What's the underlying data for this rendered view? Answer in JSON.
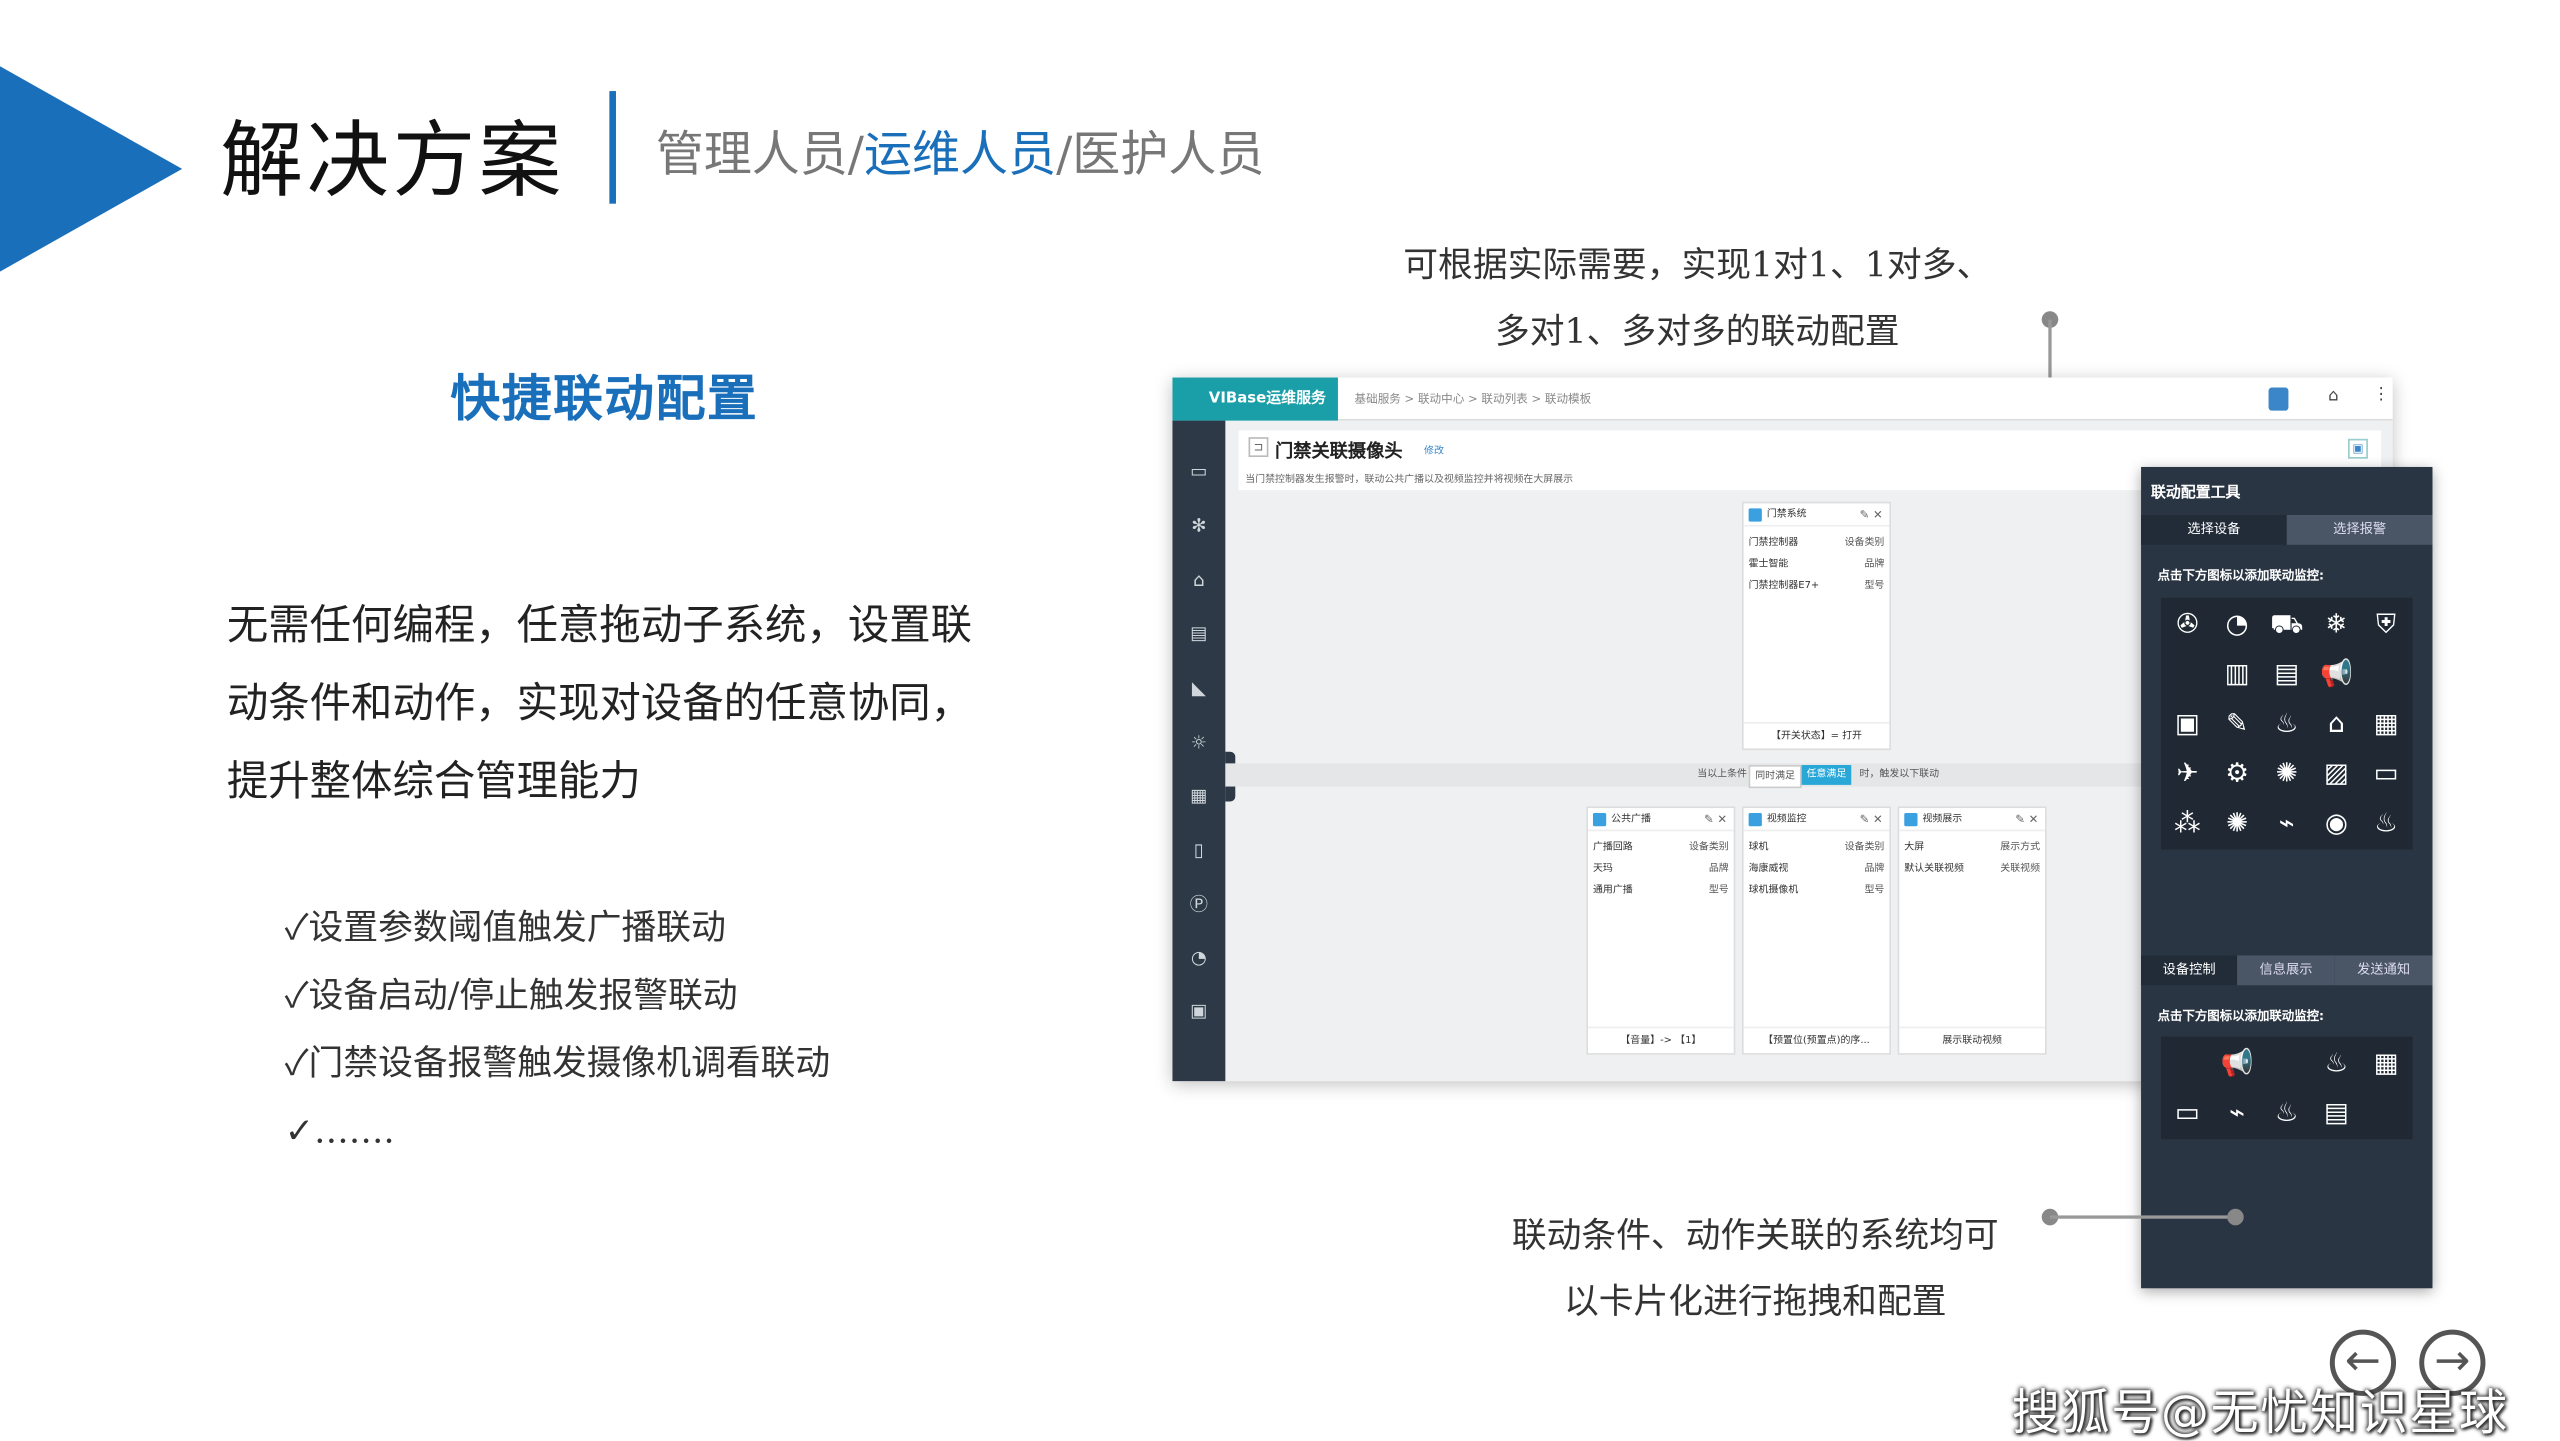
{
  "slide": {
    "title": "解决方案",
    "roles": {
      "a": "管理人员/",
      "b": "运维人员",
      "c": "/医护人员"
    },
    "feature_title": "快捷联动配置",
    "description": "无需任何编程，任意拖动子系统，设置联动条件和动作，实现对设备的任意协同，提升整体综合管理能力",
    "checks": [
      "✓设置参数阈值触发广播联动",
      "✓设备启动/停止触发报警联动",
      "✓门禁设备报警触发摄像机调看联动",
      "✓……."
    ],
    "caption_top_1": "可根据实际需要，实现1对1、1对多、",
    "caption_top_2": "多对1、多对多的联动配置",
    "caption_bottom_1": "联动条件、动作关联的系统均可",
    "caption_bottom_2": "以卡片化进行拖拽和配置",
    "watermark": "搜狐号@无忧知识星球",
    "accent": "#1a6fbb"
  },
  "app": {
    "brand": "VIBase运维服务",
    "breadcrumb": "基础服务 > 联动中心 > 联动列表 > 联动模板",
    "page_title": "门禁关联摄像头",
    "edit_label": "修改",
    "subtitle": "当门禁控制器发生报警时，联动公共广播以及视频监控并将视频在大屏展示",
    "condition_card": {
      "title": "门禁系统",
      "rows": [
        [
          "门禁控制器",
          "设备类别"
        ],
        [
          "霍士智能",
          "品牌"
        ],
        [
          "门禁控制器E7+",
          "型号"
        ]
      ],
      "footer": "【开关状态】= 打开"
    },
    "cond_bar": {
      "pre": "当以上条件",
      "opt1": "同时满足",
      "opt2": "任意满足",
      "post": "时，触发以下联动"
    },
    "action_cards": [
      {
        "title": "公共广播",
        "rows": [
          [
            "广播回路",
            "设备类别"
          ],
          [
            "天玛",
            "品牌"
          ],
          [
            "通用广播",
            "型号"
          ]
        ],
        "footer": "【音量】-> 【1】"
      },
      {
        "title": "视频监控",
        "rows": [
          [
            "球机",
            "设备类别"
          ],
          [
            "海康威视",
            "品牌"
          ],
          [
            "球机摄像机",
            "型号"
          ]
        ],
        "footer": "【预置位(预置点)的序..."
      },
      {
        "title": "视频展示",
        "rows": [
          [
            "大屏",
            "展示方式"
          ],
          [
            "默认关联视频",
            "关联视频"
          ]
        ],
        "footer": "展示联动视频"
      }
    ]
  },
  "tool": {
    "title": "联动配置工具",
    "tabs_top": [
      "选择设备",
      "选择报警"
    ],
    "hint": "点击下方图标以添加联动监控:",
    "tabs_bottom": [
      "设备控制",
      "信息展示",
      "发送通知"
    ],
    "hint2": "点击下方图标以添加联动监控:",
    "icons_top": [
      "✇",
      "◔",
      "⛟",
      "❄",
      "⛨",
      "",
      "▥",
      "▤",
      "📢",
      "",
      "▣",
      "✎",
      "♨",
      "⌂",
      "▦",
      "✈",
      "⚙",
      "✺",
      "▨",
      "▭",
      "⁂",
      "✺",
      "⌁",
      "◉",
      "♨"
    ],
    "icons_bottom": [
      "",
      "📢",
      "",
      "♨",
      "▦",
      "▭",
      "⌁",
      "♨",
      "▤"
    ]
  }
}
